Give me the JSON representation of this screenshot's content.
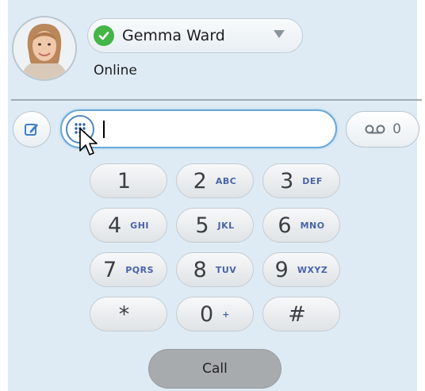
{
  "user": {
    "name": "Gemma Ward",
    "presence": "Online",
    "status_color": "#44b547"
  },
  "dial": {
    "number_value": "",
    "voicemail_count": "0"
  },
  "keypad": [
    {
      "digit": "1",
      "letters": ""
    },
    {
      "digit": "2",
      "letters": "ABC"
    },
    {
      "digit": "3",
      "letters": "DEF"
    },
    {
      "digit": "4",
      "letters": "GHI"
    },
    {
      "digit": "5",
      "letters": "JKL"
    },
    {
      "digit": "6",
      "letters": "MNO"
    },
    {
      "digit": "7",
      "letters": "PQRS"
    },
    {
      "digit": "8",
      "letters": "TUV"
    },
    {
      "digit": "9",
      "letters": "WXYZ"
    },
    {
      "digit": "*",
      "letters": ""
    },
    {
      "digit": "0",
      "letters": "+"
    },
    {
      "digit": "#",
      "letters": ""
    }
  ],
  "call_label": "Call",
  "icons": {
    "status": "check-icon",
    "compose": "edit-icon",
    "dialpad": "dialpad-icon",
    "voicemail": "voicemail-icon",
    "avatar": "user-photo"
  }
}
